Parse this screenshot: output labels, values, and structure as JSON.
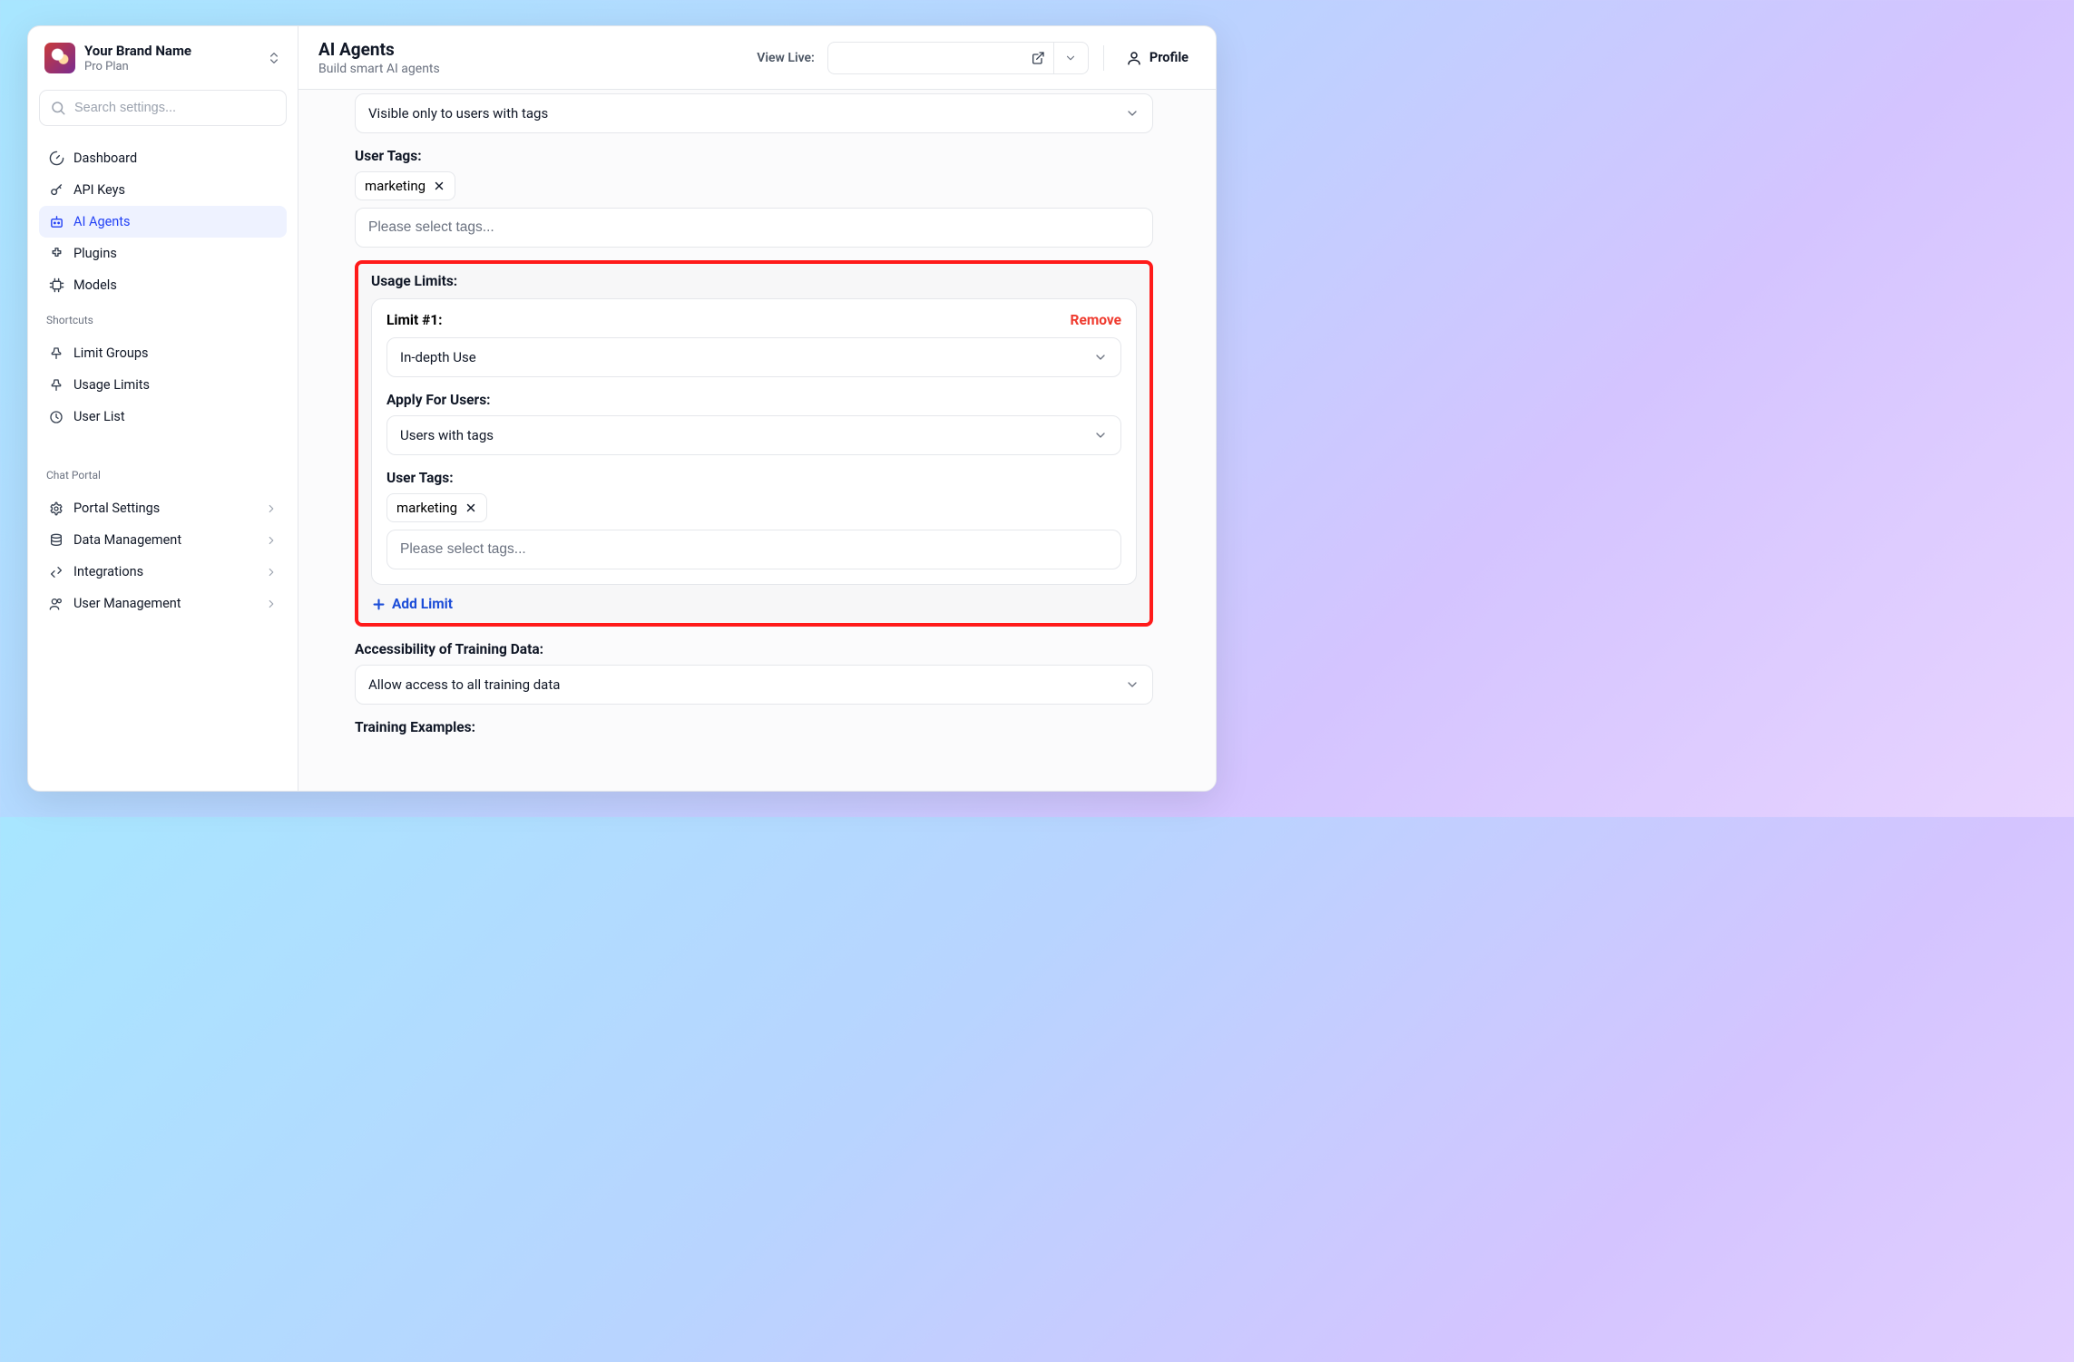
{
  "brand": {
    "name": "Your Brand Name",
    "plan": "Pro Plan"
  },
  "search": {
    "placeholder": "Search settings..."
  },
  "nav": {
    "main": [
      {
        "icon": "gauge",
        "label": "Dashboard"
      },
      {
        "icon": "key",
        "label": "API Keys"
      },
      {
        "icon": "bot",
        "label": "AI Agents",
        "active": true
      },
      {
        "icon": "puzzle",
        "label": "Plugins"
      },
      {
        "icon": "chip",
        "label": "Models"
      }
    ],
    "shortcuts_heading": "Shortcuts",
    "shortcuts": [
      {
        "icon": "pin",
        "label": "Limit Groups"
      },
      {
        "icon": "pin",
        "label": "Usage Limits"
      },
      {
        "icon": "clock",
        "label": "User List"
      }
    ],
    "chat_heading": "Chat Portal",
    "chat": [
      {
        "icon": "gear",
        "label": "Portal Settings"
      },
      {
        "icon": "db",
        "label": "Data Management"
      },
      {
        "icon": "tools",
        "label": "Integrations"
      },
      {
        "icon": "users",
        "label": "User Management"
      }
    ]
  },
  "header": {
    "title": "AI Agents",
    "subtitle": "Build smart AI agents",
    "view_live_label": "View Live:",
    "profile_label": "Profile"
  },
  "form": {
    "visibility_value": "Visible only to users with tags",
    "user_tags_label": "User Tags:",
    "tags": [
      "marketing"
    ],
    "tags_placeholder": "Please select tags...",
    "usage_limits_label": "Usage Limits:",
    "limit": {
      "title": "Limit #1:",
      "remove": "Remove",
      "preset_value": "In-depth Use",
      "apply_for_label": "Apply For Users:",
      "apply_for_value": "Users with tags",
      "user_tags_label": "User Tags:",
      "tags": [
        "marketing"
      ],
      "tags_placeholder": "Please select tags..."
    },
    "add_limit": "Add Limit",
    "training_access_label": "Accessibility of Training Data:",
    "training_access_value": "Allow access to all training data",
    "training_examples_label": "Training Examples:"
  }
}
